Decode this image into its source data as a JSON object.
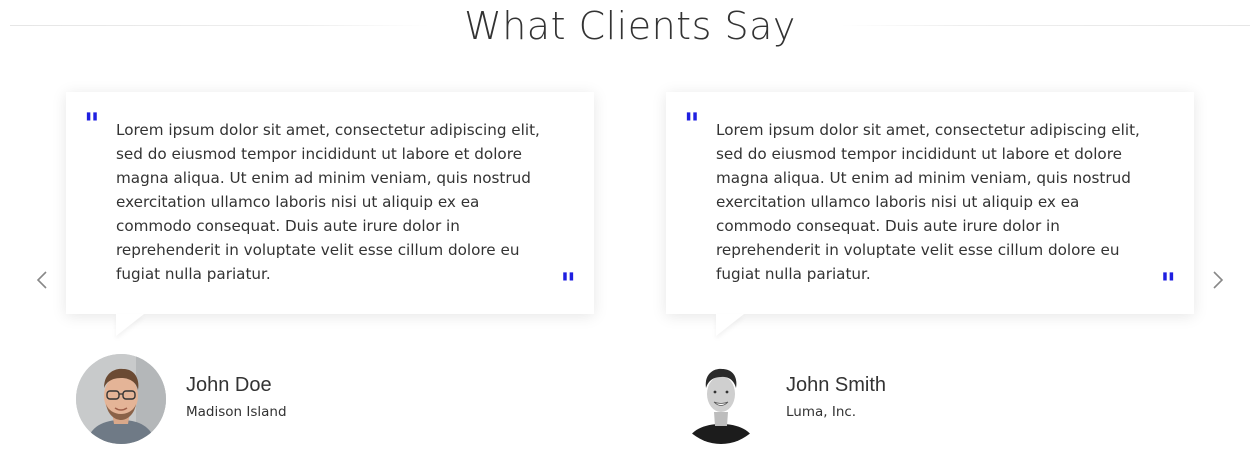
{
  "section": {
    "title": "What Clients Say"
  },
  "carousel": {
    "prev_icon": "chevron-left-icon",
    "next_icon": "chevron-right-icon",
    "accent_color": "#1f1fe0"
  },
  "testimonials": [
    {
      "text": "Lorem ipsum dolor sit amet, consectetur adipiscing elit, sed do eiusmod tempor incididunt ut labore et dolore magna aliqua. Ut enim ad minim veniam, quis nostrud exercitation ullamco laboris nisi ut aliquip ex ea commodo consequat. Duis aute irure dolor in reprehenderit in voluptate velit esse cillum dolore eu fugiat nulla pariatur.",
      "name": "John Doe",
      "company": "Madison Island"
    },
    {
      "text": "Lorem ipsum dolor sit amet, consectetur adipiscing elit, sed do eiusmod tempor incididunt ut labore et dolore magna aliqua. Ut enim ad minim veniam, quis nostrud exercitation ullamco laboris nisi ut aliquip ex ea commodo consequat. Duis aute irure dolor in reprehenderit in voluptate velit esse cillum dolore eu fugiat nulla pariatur.",
      "name": "John Smith",
      "company": "Luma, Inc."
    }
  ]
}
